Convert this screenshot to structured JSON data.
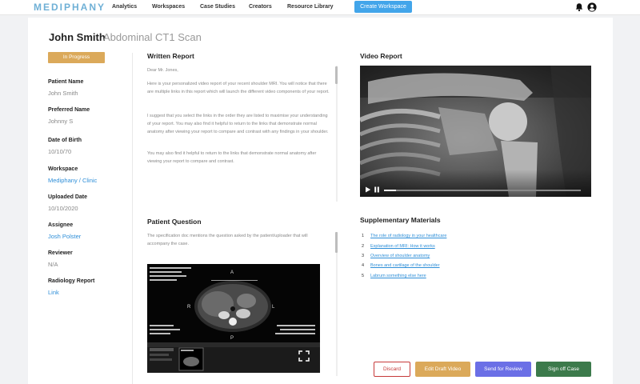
{
  "nav": {
    "logo": "MEDIPHANY",
    "links": [
      "Analytics",
      "Workspaces",
      "Case Studies",
      "Creators",
      "Resource Library"
    ],
    "create_button": "Create Workspace"
  },
  "header": {
    "patient_name": "John Smith",
    "scan_name": "Abdominal CT1 Scan"
  },
  "status": "In Progress",
  "fields": [
    {
      "label": "Patient Name",
      "value": "John Smith",
      "link": false
    },
    {
      "label": "Preferred Name",
      "value": "Johnny S",
      "link": false
    },
    {
      "label": "Date of Birth",
      "value": "10/10/70",
      "link": false
    },
    {
      "label": "Workspace",
      "value": "Mediphany / Clinic",
      "link": true
    },
    {
      "label": "Uploaded Date",
      "value": "10/10/2020",
      "link": false
    },
    {
      "label": "Assignee",
      "value": "Josh Polster",
      "link": true
    },
    {
      "label": "Reviewer",
      "value": "N/A",
      "link": false
    },
    {
      "label": "Radiology Report",
      "value": "Link",
      "link": true
    }
  ],
  "written_report": {
    "title": "Written Report",
    "paragraphs": [
      "Dear Mr. Jones,",
      "Here is your personalized video report of your recent shoulder MRI. You will notice that there are multiple links in this report which will launch the different video components of your report.",
      "I suggest that you select the links in the order they are listed to maximise your understanding of your report. You may also find it helpful to return to the links that demonstrate normal anatomy after viewing your report to compare and contrast with any findings in your shoulder.",
      "You may also find it helpful to return to the links that demonstrate normal anatomy after viewing your report to compare and contrast."
    ]
  },
  "patient_question": {
    "title": "Patient Question",
    "text": "The specification doc mentions the question asked by the patient/uploader that will accompany the case."
  },
  "video_report": {
    "title": "Video Report",
    "progress": 0.06
  },
  "supplementary": {
    "title": "Supplementary Materials",
    "items": [
      {
        "num": "1",
        "label": "The role of radiology in your healthcare"
      },
      {
        "num": "2",
        "label": "Explanation of MRI: How it works"
      },
      {
        "num": "3",
        "label": "Overview of shoulder anatomy"
      },
      {
        "num": "4",
        "label": "Bones and cartilage of the shoulder"
      },
      {
        "num": "5",
        "label": "Labrum something else here"
      }
    ]
  },
  "actions": {
    "discard": "Discard",
    "draft": "Edit Draft Video",
    "review": "Send for Review",
    "signoff": "Sign off Case"
  },
  "colors": {
    "accent": "#42a5ea",
    "status": "#dba95a",
    "link": "#2f8fd8",
    "discard": "#c63a3a",
    "review": "#6b6fe6",
    "signoff": "#3c7a4b"
  },
  "icons": [
    "bell-icon",
    "user-icon",
    "play-icon",
    "pause-icon",
    "fullscreen-icon"
  ]
}
